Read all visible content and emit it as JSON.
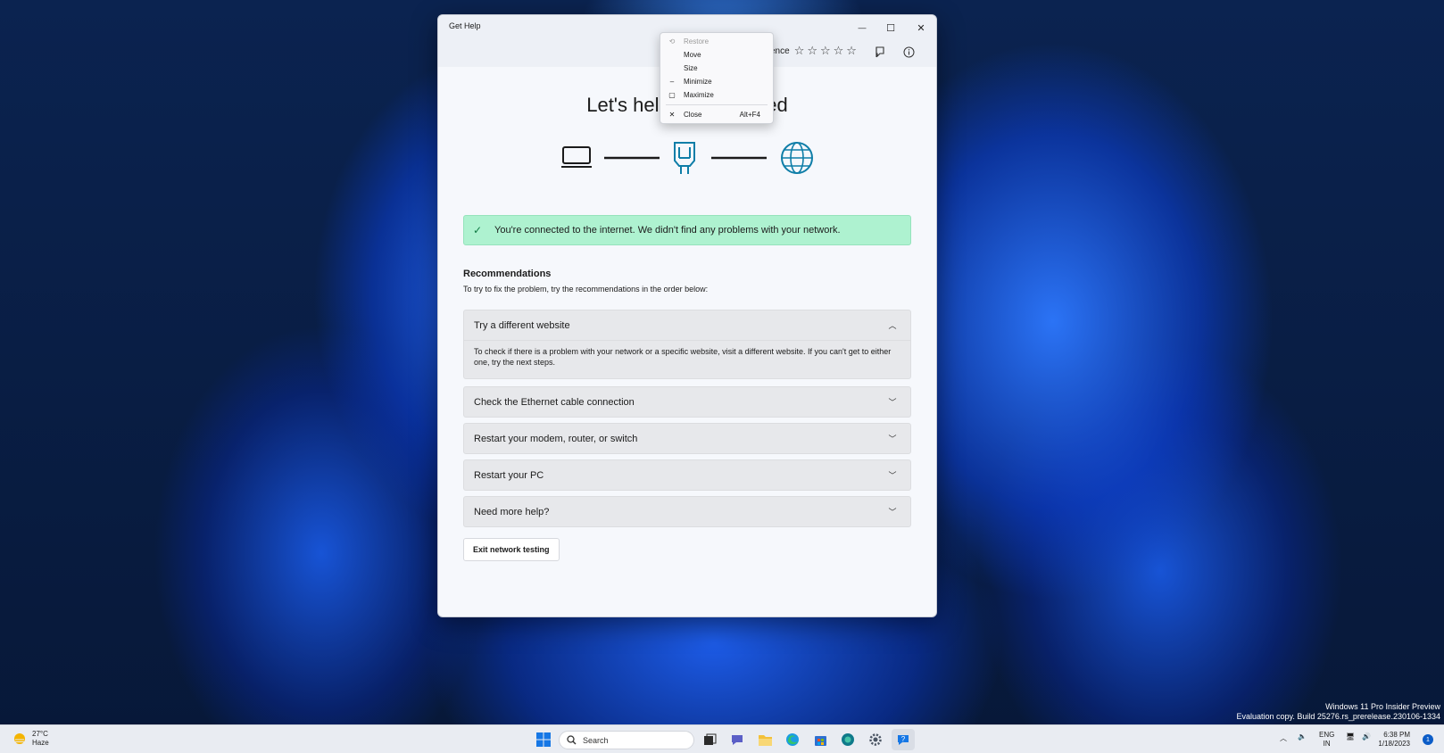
{
  "window": {
    "title": "Get Help",
    "minimize": "—",
    "maximize": "☐",
    "close": "✕",
    "feedback_label": "ence",
    "stars": "☆☆☆☆☆"
  },
  "main": {
    "headline": "Let's help y          ected",
    "banner": "You're connected to the internet. We didn't find any problems with your network.",
    "rec_title": "Recommendations",
    "rec_sub": "To try to fix the problem, try the recommendations in the order below:",
    "accordion": [
      {
        "title": "Try a different website",
        "expanded": true,
        "body": "To check if there is a problem with your network or a specific website, visit a different website. If you can't get to either one, try the next steps."
      },
      {
        "title": "Check the Ethernet cable connection",
        "expanded": false
      },
      {
        "title": "Restart your modem, router, or switch",
        "expanded": false
      },
      {
        "title": "Restart your PC",
        "expanded": false
      },
      {
        "title": "Need more help?",
        "expanded": false
      }
    ],
    "exit_button": "Exit network testing"
  },
  "context_menu": {
    "items": [
      {
        "label": "Restore",
        "icon": "restore-icon",
        "disabled": true
      },
      {
        "label": "Move",
        "icon": "",
        "disabled": false
      },
      {
        "label": "Size",
        "icon": "",
        "disabled": false
      },
      {
        "label": "Minimize",
        "icon": "minimize-icon",
        "disabled": false
      },
      {
        "label": "Maximize",
        "icon": "maximize-icon",
        "disabled": false
      },
      {
        "label": "Close",
        "icon": "close-icon",
        "accel": "Alt+F4",
        "disabled": false
      }
    ]
  },
  "taskbar": {
    "weather_temp": "27°C",
    "weather_cond": "Haze",
    "search_placeholder": "Search",
    "lang": "ENG",
    "region": "IN",
    "time": "6:38 PM",
    "date": "1/18/2023",
    "notifications": "1"
  },
  "watermark": {
    "line1": "Windows 11 Pro Insider Preview",
    "line2": "Evaluation copy. Build 25276.rs_prerelease.230106-1334"
  },
  "colors": {
    "banner_bg": "#aef2d0",
    "accent": "#0b5cc7",
    "accordion_bg": "#e7e8eb"
  }
}
